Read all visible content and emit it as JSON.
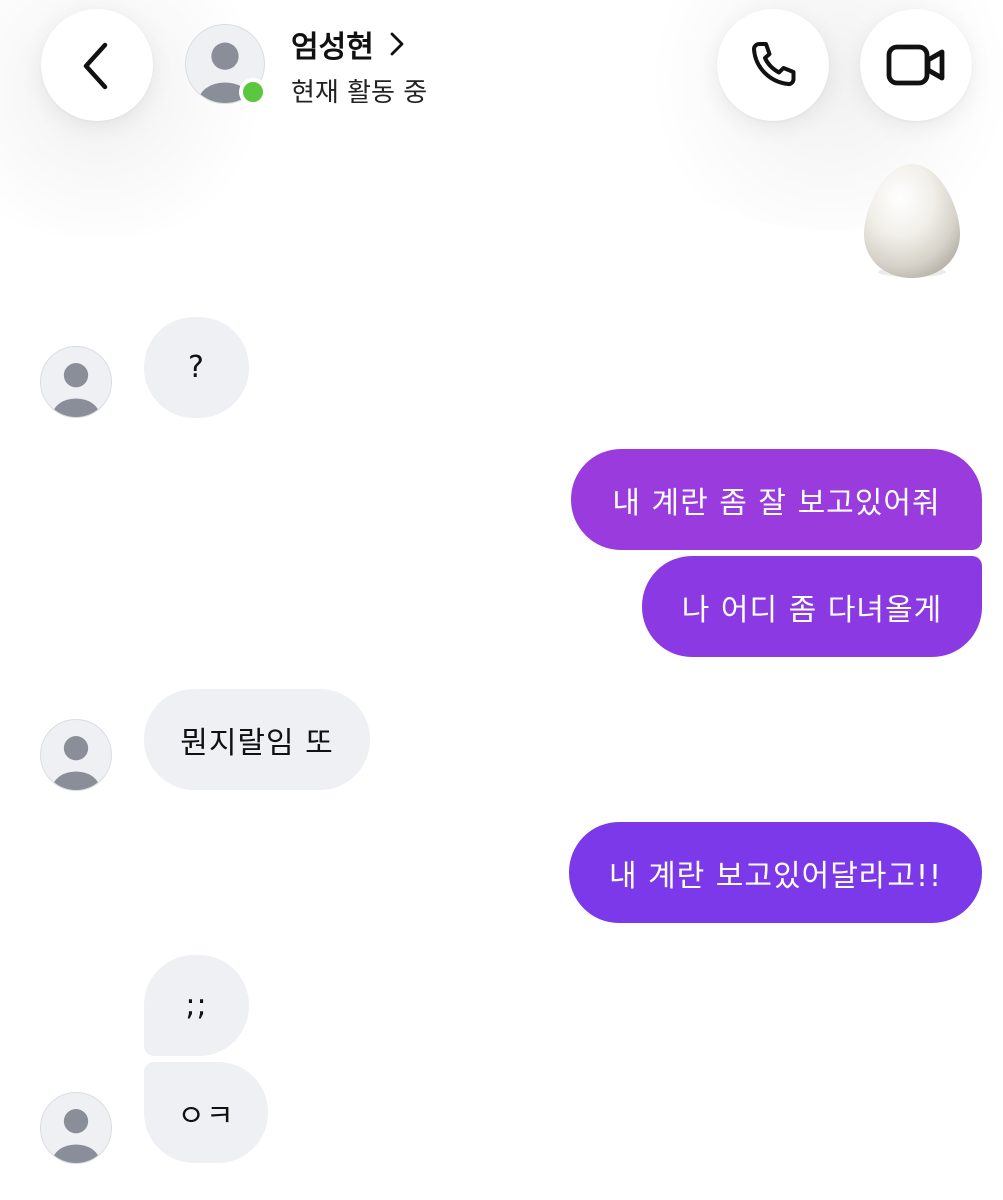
{
  "header": {
    "contact_name": "엄성현",
    "name_chevron": ">",
    "status": "현재 활동 중",
    "back_icon": "chevron-left-icon",
    "call_icon": "phone-icon",
    "video_icon": "video-camera-icon",
    "online_color": "#5ac73e"
  },
  "messages": [
    {
      "sender": "me",
      "type": "emoji",
      "icon": "egg-icon"
    },
    {
      "sender": "them",
      "text": "?"
    },
    {
      "sender": "me",
      "text": "내 계란 좀 잘 보고있어줘"
    },
    {
      "sender": "me",
      "text": "나 어디 좀 다녀올게"
    },
    {
      "sender": "them",
      "text": "뭔지랄임 또"
    },
    {
      "sender": "me",
      "text": "내 계란 보고있어달라고!!"
    },
    {
      "sender": "them",
      "text": ";;"
    },
    {
      "sender": "them",
      "text": "ㅇㅋ"
    }
  ],
  "colors": {
    "incoming_bubble": "#eff0f4",
    "outgoing_gradient_top": "#a23ad9",
    "outgoing_gradient_bottom": "#6c3cf0"
  }
}
